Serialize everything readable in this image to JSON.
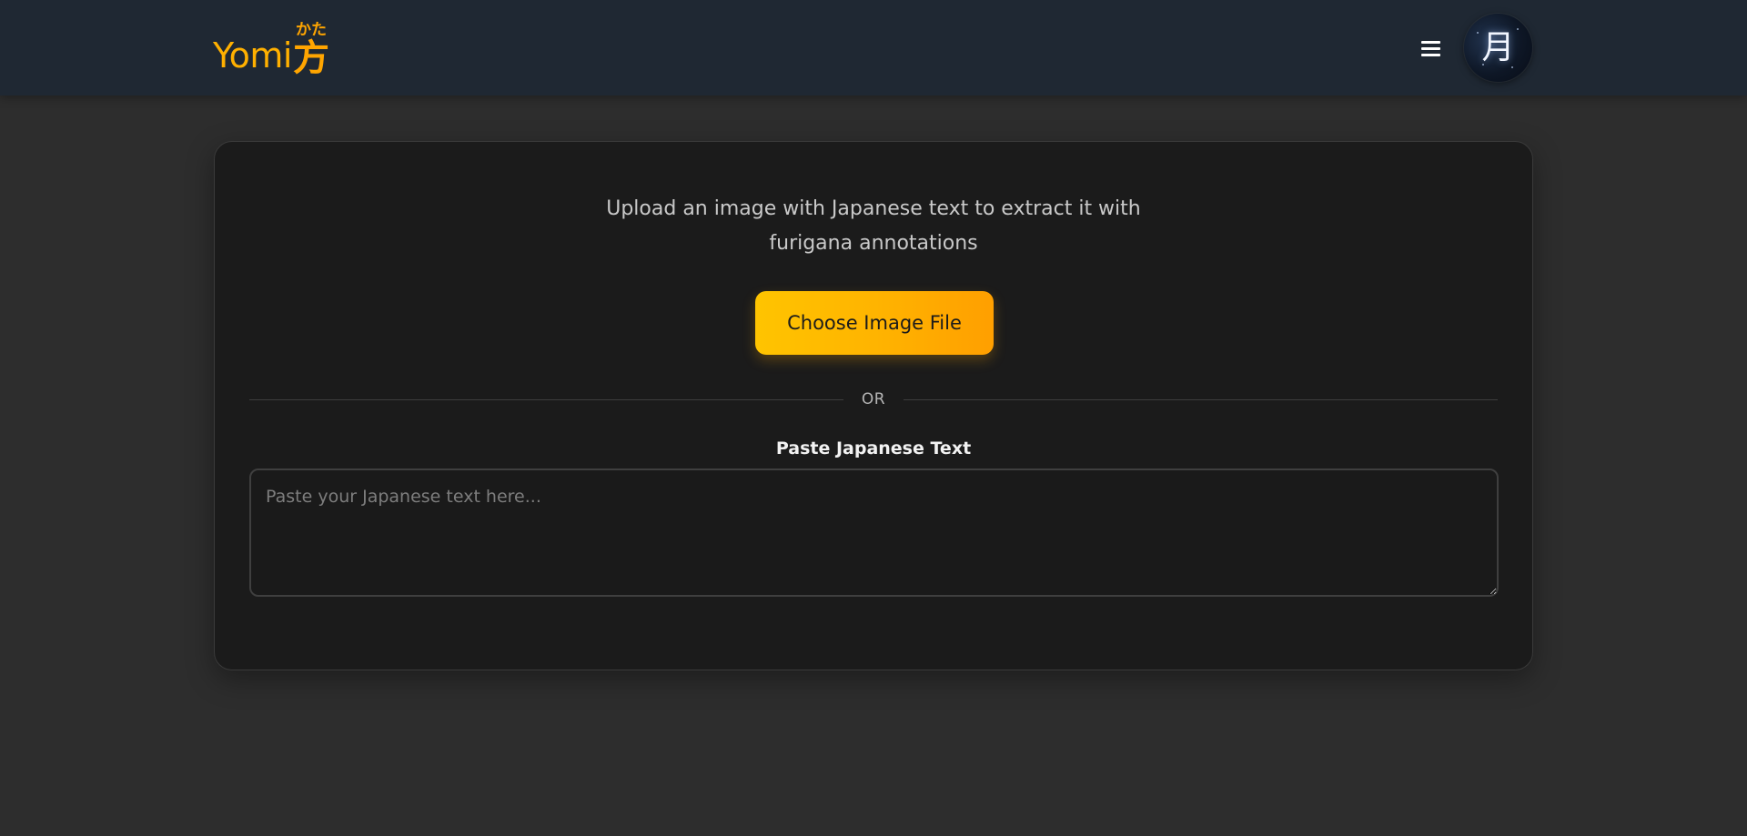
{
  "header": {
    "logo": {
      "text": "Yomi",
      "ruby_base": "方",
      "ruby_reading": "かた"
    },
    "menu_icon": "hamburger-menu-icon",
    "avatar_glyph": "月"
  },
  "main": {
    "intro_text": "Upload an image with Japanese text to extract it with furigana annotations",
    "upload_button_label": "Choose Image File",
    "divider_label": "OR",
    "paste_label": "Paste Japanese Text",
    "paste_placeholder": "Paste your Japanese text here...",
    "paste_value": ""
  },
  "colors": {
    "header_bg": "#1f2833",
    "page_bg": "#2d2d2d",
    "card_bg": "#1b1b1b",
    "accent": "#ffb000",
    "accent_gradient_end": "#ff9f00"
  }
}
